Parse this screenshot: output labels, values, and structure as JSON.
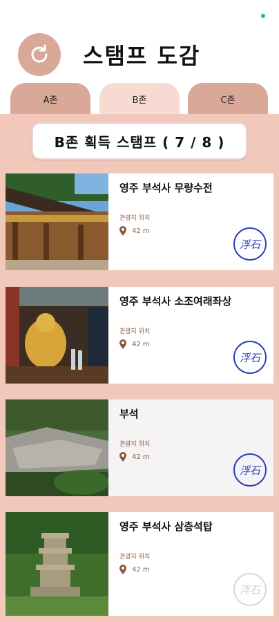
{
  "header": {
    "title": "스탬프 도감",
    "refresh_icon": "refresh-icon"
  },
  "tabs": [
    {
      "label": "A존",
      "active": false
    },
    {
      "label": "B존",
      "active": true
    },
    {
      "label": "C존",
      "active": false
    }
  ],
  "count_label": "B존 획득 스탬프 ( 7 / 8 )",
  "cards": [
    {
      "name": "영주 부석사 무량수전",
      "location_label": "관광지 위치",
      "distance": "42 m",
      "stamp": "浮石",
      "collected": true
    },
    {
      "name": "영주 부석사 소조여래좌상",
      "location_label": "관광지 위치",
      "distance": "42 m",
      "stamp": "浮石",
      "collected": true
    },
    {
      "name": "부석",
      "location_label": "관광지 위치",
      "distance": "42 m",
      "stamp": "浮石",
      "collected": true
    },
    {
      "name": "영주 부석사 삼층석탑",
      "location_label": "관광지 위치",
      "distance": "42 m",
      "stamp": "浮石",
      "collected": false
    }
  ],
  "colors": {
    "accent": "#d9a898",
    "panel": "#f2c8bb",
    "stamp_blue": "#2a3fb8",
    "location_brown": "#8b5a3c"
  }
}
